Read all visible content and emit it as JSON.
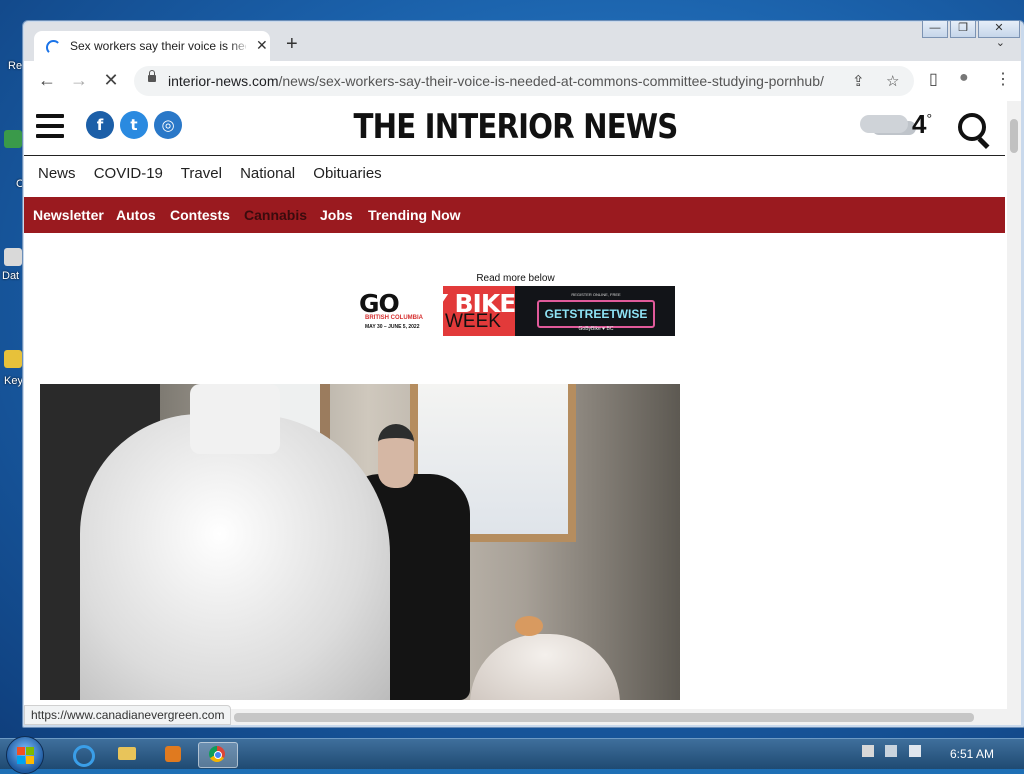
{
  "desktop": {
    "icon_labels": [
      "Re",
      "C",
      "Dat",
      "Key"
    ]
  },
  "window": {
    "controls": {
      "minimize": "—",
      "restore": "❐",
      "close": "✕"
    }
  },
  "tab": {
    "title": "Sex workers say their voice is needed at Commons committee studying Pornhub",
    "close": "✕",
    "new_tab": "+",
    "tab_search": "⌄"
  },
  "toolbar": {
    "back": "←",
    "forward": "→",
    "stop": "✕",
    "url_domain": "interior-news.com",
    "url_path": "/news/sex-workers-say-their-voice-is-needed-at-commons-committee-studying-pornhub/",
    "share_icon": "⇪",
    "star_icon": "☆",
    "sidepanel_icon": "▯",
    "profile_icon": "●",
    "menu_icon": "⋮"
  },
  "site": {
    "logo": "THE INTERIOR NEWS",
    "social": {
      "facebook": "f",
      "twitter": "t",
      "instagram": "◎"
    },
    "weather_temp": "4",
    "weather_degree": "°",
    "nav_primary": [
      "News",
      "COVID-19",
      "Travel",
      "National",
      "Obituaries"
    ],
    "nav_secondary": [
      "Newsletter",
      "Autos",
      "Contests",
      "Cannabis",
      "Jobs",
      "Trending Now"
    ]
  },
  "ad": {
    "read_more": "Read more below",
    "go": "GO",
    "by_bike": "BY BIKE",
    "week": "WEEK",
    "region": "BRITISH COLUMBIA",
    "dates": "MAY 30 – JUNE 5, 2022",
    "register": "REGISTER ONLINE, FREE",
    "cta": "GETSTREETWISE",
    "sponsor": "GoByBike ♥ BC"
  },
  "status_url": "https://www.canadianevergreen.com",
  "taskbar": {
    "time": "6:51 AM"
  }
}
